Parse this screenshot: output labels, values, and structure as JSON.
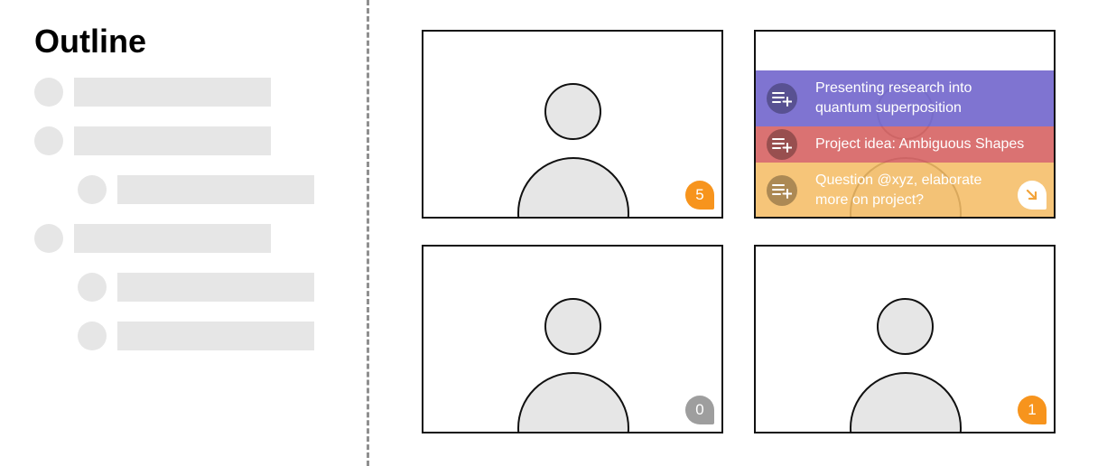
{
  "outline": {
    "title": "Outline",
    "items": [
      {
        "level": 1
      },
      {
        "level": 1
      },
      {
        "level": 2
      },
      {
        "level": 1
      },
      {
        "level": 2
      },
      {
        "level": 2
      }
    ]
  },
  "tiles": [
    {
      "id": "top-left",
      "badge": "5",
      "badge_color": "#f7941d"
    },
    {
      "id": "top-right",
      "overlay_items": [
        {
          "text": "Presenting research into\nquantum superposition",
          "color": "#7b6fd0"
        },
        {
          "text": "Project idea: Ambiguous Shapes",
          "color": "#d86a6a"
        },
        {
          "text": "Question @xyz, elaborate\nmore on project?",
          "color": "#f5bd66"
        }
      ],
      "icon": "add-to-list-icon",
      "collapse_icon": "collapse-arrow-icon"
    },
    {
      "id": "bottom-left",
      "badge": "0",
      "badge_color": "#9e9e9e"
    },
    {
      "id": "bottom-right",
      "badge": "1",
      "badge_color": "#f7941d"
    }
  ],
  "colors": {
    "placeholder": "#e6e6e6",
    "divider": "#8f8f8f",
    "accent_orange": "#f7941d",
    "collapse_arrow": "#f2a33a"
  }
}
